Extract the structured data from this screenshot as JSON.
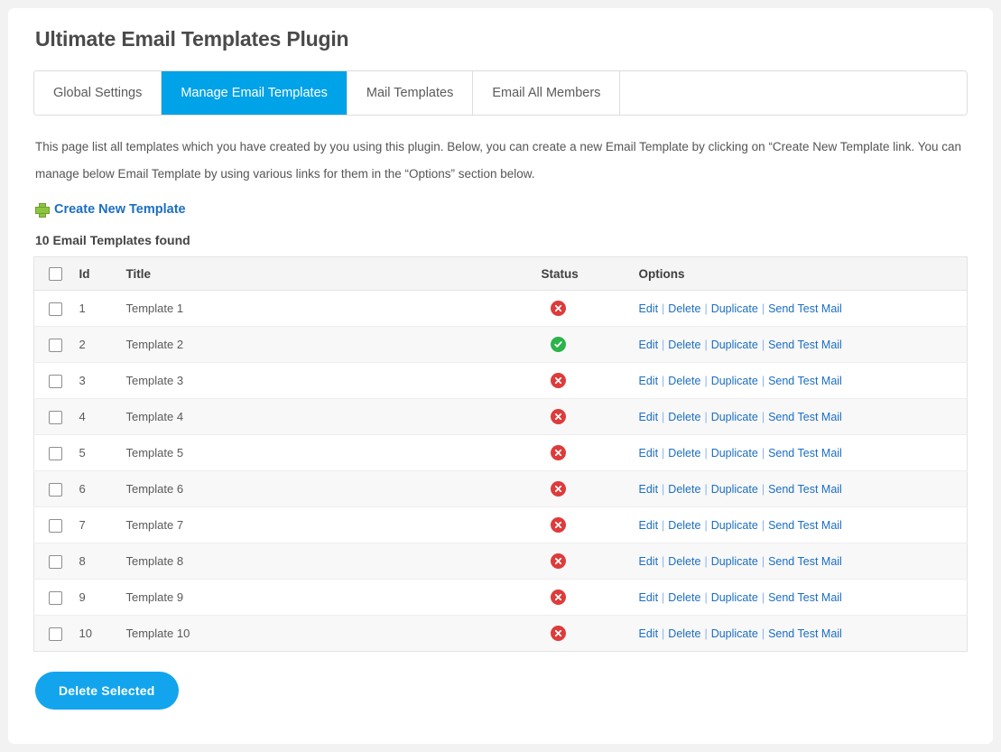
{
  "page": {
    "title": "Ultimate Email Templates Plugin",
    "intro": "This page list all templates which you have created by you using this plugin. Below, you can create a new Email Template by clicking on “Create New Template link. You can manage below Email Template by using various links for them in the “Options” section below.",
    "create_link_label": "Create New Template",
    "create_link_icon": "plus-icon",
    "found_count_label": "10 Email Templates found",
    "delete_selected_label": "Delete Selected"
  },
  "tabs": [
    {
      "label": "Global Settings",
      "active": false
    },
    {
      "label": "Manage Email Templates",
      "active": true
    },
    {
      "label": "Mail Templates",
      "active": false
    },
    {
      "label": "Email All Members",
      "active": false
    }
  ],
  "table": {
    "columns": [
      "",
      "Id",
      "Title",
      "Status",
      "Options"
    ],
    "option_links": [
      "Edit",
      "Delete",
      "Duplicate",
      "Send Test Mail"
    ],
    "option_separator": "|",
    "rows": [
      {
        "id": "1",
        "title": "Template 1",
        "status": "inactive",
        "status_icon": "cross-circle-icon"
      },
      {
        "id": "2",
        "title": "Template 2",
        "status": "active",
        "status_icon": "check-circle-icon"
      },
      {
        "id": "3",
        "title": "Template 3",
        "status": "inactive",
        "status_icon": "cross-circle-icon"
      },
      {
        "id": "4",
        "title": "Template 4",
        "status": "inactive",
        "status_icon": "cross-circle-icon"
      },
      {
        "id": "5",
        "title": "Template 5",
        "status": "inactive",
        "status_icon": "cross-circle-icon"
      },
      {
        "id": "6",
        "title": "Template 6",
        "status": "inactive",
        "status_icon": "cross-circle-icon"
      },
      {
        "id": "7",
        "title": "Template 7",
        "status": "inactive",
        "status_icon": "cross-circle-icon"
      },
      {
        "id": "8",
        "title": "Template 8",
        "status": "inactive",
        "status_icon": "cross-circle-icon"
      },
      {
        "id": "9",
        "title": "Template 9",
        "status": "inactive",
        "status_icon": "cross-circle-icon"
      },
      {
        "id": "10",
        "title": "Template 10",
        "status": "inactive",
        "status_icon": "cross-circle-icon"
      }
    ]
  },
  "colors": {
    "accent_blue": "#00a2e8",
    "button_blue": "#12a5ed",
    "link_blue": "#1b6ec2",
    "status_inactive_red": "#de3b3b",
    "status_active_green": "#2cb34a",
    "plus_green": "#8cc63f",
    "page_background": "#f2f2f2",
    "card_background": "#ffffff"
  }
}
